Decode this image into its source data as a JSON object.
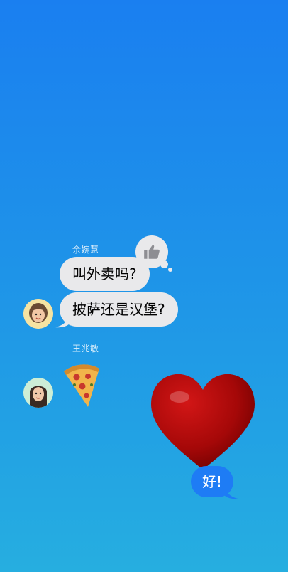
{
  "conversation": {
    "messages": [
      {
        "sender": "余婉慧",
        "bubbles": [
          "叫外卖吗?",
          "披萨还是汉堡?"
        ],
        "tapback": "thumbs-up-icon",
        "avatar": "memoji-avatar-1"
      },
      {
        "sender": "王兆敏",
        "sticker": "pizza-icon",
        "avatar": "memoji-avatar-2"
      }
    ],
    "outgoing": {
      "sticker": "red-heart-icon",
      "text": "好!"
    }
  },
  "colors": {
    "background_top": "#1a7ff0",
    "background_bottom": "#26aee0",
    "incoming_bubble": "#e9e9eb",
    "outgoing_bubble": "#1e7cf5"
  }
}
